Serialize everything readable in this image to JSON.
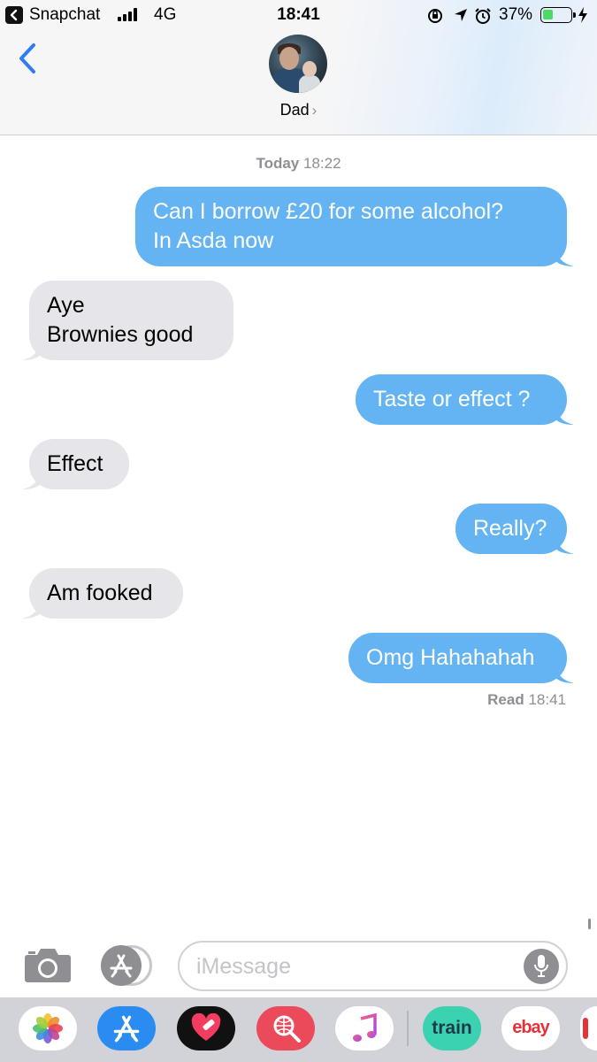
{
  "status_bar": {
    "back_app": "Snapchat",
    "network": "4G",
    "time": "18:41",
    "battery_percent": "37%",
    "battery_level": 0.37
  },
  "header": {
    "contact_name": "Dad",
    "name_chevron": "›"
  },
  "conversation": {
    "timestamp_day": "Today",
    "timestamp_time": "18:22",
    "messages": [
      {
        "from": "me",
        "lines": [
          "Can I borrow £20 for some alcohol?",
          "In Asda now"
        ]
      },
      {
        "from": "them",
        "lines": [
          "Aye",
          "Brownies  good"
        ]
      },
      {
        "from": "me",
        "lines": [
          "Taste or effect ?"
        ]
      },
      {
        "from": "them",
        "lines": [
          "Effect"
        ]
      },
      {
        "from": "me",
        "lines": [
          "Really?"
        ]
      },
      {
        "from": "them",
        "lines": [
          "Am fooked"
        ]
      },
      {
        "from": "me",
        "lines": [
          "Omg Hahahahah"
        ]
      }
    ],
    "receipt_label": "Read",
    "receipt_time": "18:41"
  },
  "compose": {
    "placeholder": "iMessage"
  },
  "app_drawer": {
    "apps": [
      {
        "icon": "photos-icon",
        "label": ""
      },
      {
        "icon": "app-store-icon",
        "label": ""
      },
      {
        "icon": "heart-sticker-icon",
        "label": ""
      },
      {
        "icon": "web-search-icon",
        "label": ""
      },
      {
        "icon": "music-icon",
        "label": ""
      },
      {
        "icon": "trainline-icon",
        "label": "train"
      },
      {
        "icon": "ebay-icon",
        "label": "ebay"
      }
    ]
  },
  "colors": {
    "sent_bubble": "#64b4f4",
    "received_bubble": "#e5e5ea",
    "accent": "#2f7cf6",
    "battery_fill": "#4cd964"
  }
}
